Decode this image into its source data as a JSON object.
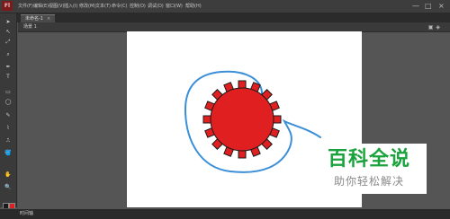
{
  "app": {
    "logo": "Fl"
  },
  "menu": [
    {
      "label": "文件(F)"
    },
    {
      "label": "编辑(E)"
    },
    {
      "label": "视图(V)"
    },
    {
      "label": "插入(I)"
    },
    {
      "label": "修改(M)"
    },
    {
      "label": "文本(T)"
    },
    {
      "label": "命令(C)"
    },
    {
      "label": "控制(O)"
    },
    {
      "label": "调试(D)"
    },
    {
      "label": "窗口(W)"
    },
    {
      "label": "帮助(H)"
    }
  ],
  "window_controls": {
    "minimize": "—",
    "maximize": "□",
    "close": "×"
  },
  "document": {
    "tab": "未命名-1",
    "close": "×"
  },
  "scene": {
    "label": "场景 1"
  },
  "timeline": {
    "tab": "时间轴"
  },
  "tools": [
    "➤",
    "↖",
    "⤢",
    "⌕",
    "✒",
    "T",
    "▭",
    "◯",
    "✎",
    "⌇",
    "⎍",
    "🪣",
    "✋",
    "🔍"
  ],
  "colors": {
    "stroke": "#1a1a1a",
    "fill": "#e02020",
    "outline": "#3a8fd8",
    "brand": "#1aa23c"
  },
  "watermark": {
    "logo": "百科全说",
    "tagline": "助你轻松解决"
  }
}
